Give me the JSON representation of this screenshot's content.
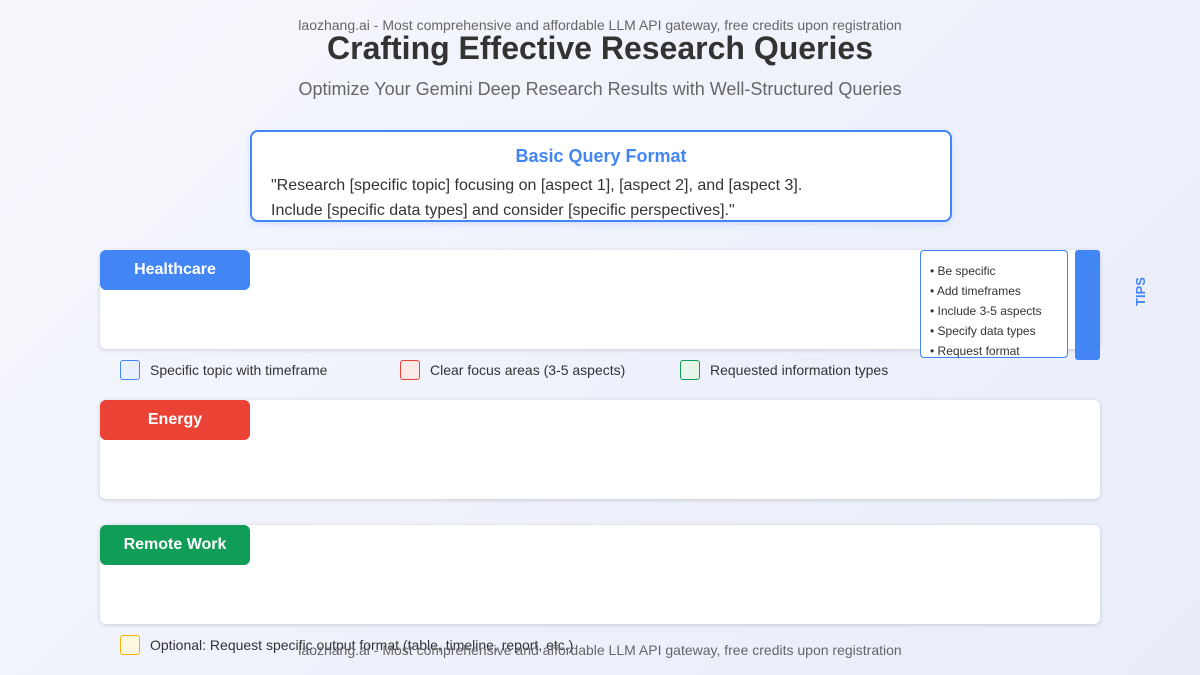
{
  "watermark": "laozhang.ai - Most comprehensive and affordable LLM API gateway, free credits upon registration",
  "header": {
    "title": "Crafting Effective Research Queries",
    "subtitle": "Optimize Your Gemini Deep Research Results with Well-Structured Queries"
  },
  "basic_format": {
    "title": "Basic Query Format",
    "line1": "\"Research [specific topic] focusing on [aspect 1], [aspect 2], and [aspect 3].",
    "line2": "Include [specific data types] and consider [specific perspectives].\""
  },
  "cards": [
    {
      "label": "Healthcare",
      "color": "#4285f4"
    },
    {
      "label": "Energy",
      "color": "#ea4335"
    },
    {
      "label": "Remote Work",
      "color": "#0f9d58"
    }
  ],
  "tips": {
    "label": "TIPS",
    "items": [
      "• Be specific",
      "• Add timeframes",
      "• Include 3-5 aspects",
      "• Specify data types",
      "• Request format"
    ]
  },
  "legend": [
    {
      "text": "Specific topic with timeframe",
      "color": "#4285f4"
    },
    {
      "text": "Clear focus areas (3-5 aspects)",
      "color": "#ea4335"
    },
    {
      "text": "Requested information types",
      "color": "#0f9d58"
    },
    {
      "text": "Optional: Request specific output format (table, timeline, report, etc.)",
      "color": "#f4b400"
    }
  ]
}
